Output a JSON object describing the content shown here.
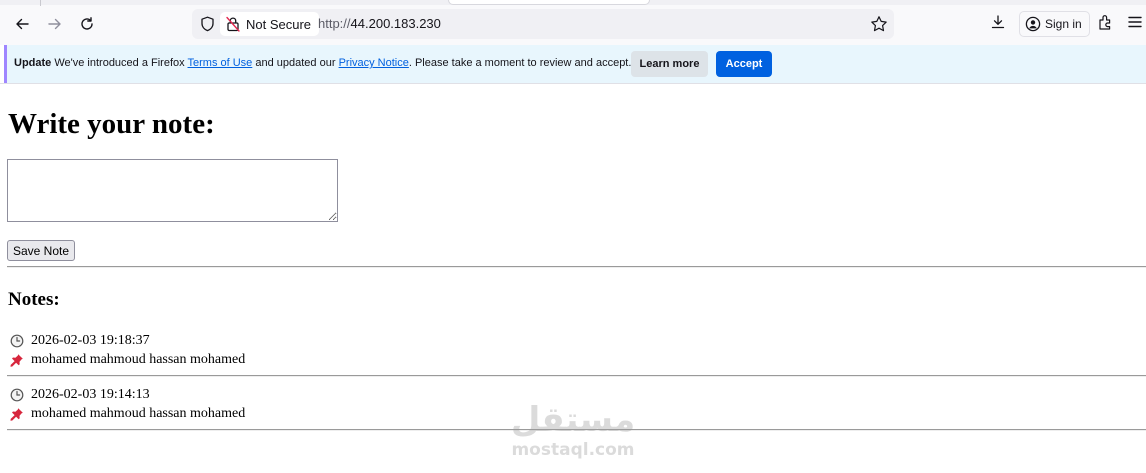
{
  "browser": {
    "address_bar": {
      "security_label": "Not Secure",
      "url_scheme": "http://",
      "url_host": "44.200.183.230"
    },
    "signin_label": "Sign in",
    "icons": [
      "back-icon",
      "forward-icon",
      "reload-icon",
      "shield-icon",
      "lock-warning-icon",
      "star-icon",
      "download-icon",
      "account-icon",
      "extensions-icon",
      "menu-icon"
    ]
  },
  "notification": {
    "bold": "Update",
    "text_1": "We've introduced a Firefox",
    "link_1": "Terms of Use",
    "text_2": "and updated our",
    "link_2": "Privacy Notice",
    "text_3": ". Please take a moment to review and accept.",
    "learn_more_label": "Learn more",
    "accept_label": "Accept"
  },
  "page": {
    "title": "Write your note:",
    "textarea_value": "",
    "save_label": "Save Note",
    "notes_heading": "Notes:",
    "notes": [
      {
        "timestamp": "2026-02-03 19:18:37",
        "text": "mohamed mahmoud hassan mohamed"
      },
      {
        "timestamp": "2026-02-03 19:14:13",
        "text": "mohamed mahmoud hassan mohamed"
      }
    ]
  },
  "watermark": {
    "logo_text": "مستقل",
    "site": "mostaql.com"
  },
  "colors": {
    "accent": "#0061e0",
    "notice_bg": "#e8f6fd",
    "pin": "#d7263d"
  }
}
